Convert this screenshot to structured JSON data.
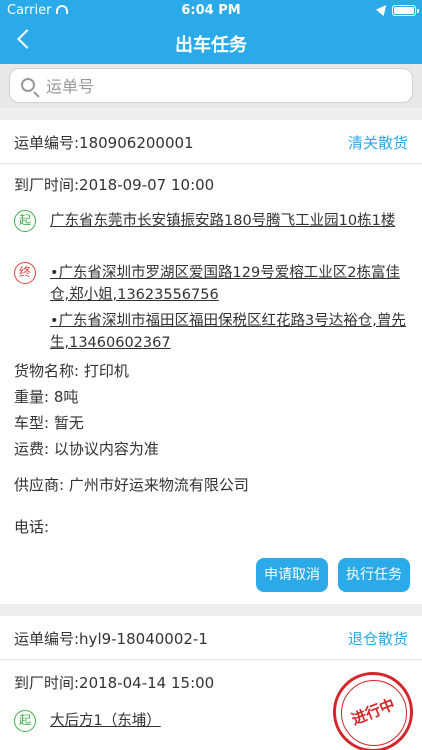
{
  "status": {
    "carrier": "Carrier",
    "time": "6:04 PM"
  },
  "nav": {
    "title": "出车任务"
  },
  "search": {
    "placeholder": "运单号"
  },
  "orders": [
    {
      "no": "运单编号:180906200001",
      "type": "清关散货",
      "arrive": "到厂时间:2018-09-07 10:00",
      "start_badge": "起",
      "start": "广东省东莞市长安镇振安路180号腾飞工业园10栋1楼",
      "end_badge": "终",
      "ends": [
        "•广东省深圳市罗湖区爱国路129号爱榕工业区2栋富佳仓,郑小姐,13623556756",
        "•广东省深圳市福田区福田保税区红花路3号达裕仓,曾先生,13460602367"
      ],
      "goods": "货物名称:  打印机",
      "weight": "重量:  8吨",
      "vehicle": "车型:  暂无",
      "fee": "运费:  以协议内容为准",
      "supplier": "供应商:  广州市好运来物流有限公司",
      "phone": "电话:",
      "cancel_label": "申请取消",
      "execute_label": "执行任务"
    },
    {
      "no": "运单编号:hyl9-18040002-1",
      "type": "退仓散货",
      "arrive": "到厂时间:2018-04-14 15:00",
      "start_badge": "起",
      "start": "大后方1（东埔）",
      "stamp": "进行中"
    }
  ]
}
